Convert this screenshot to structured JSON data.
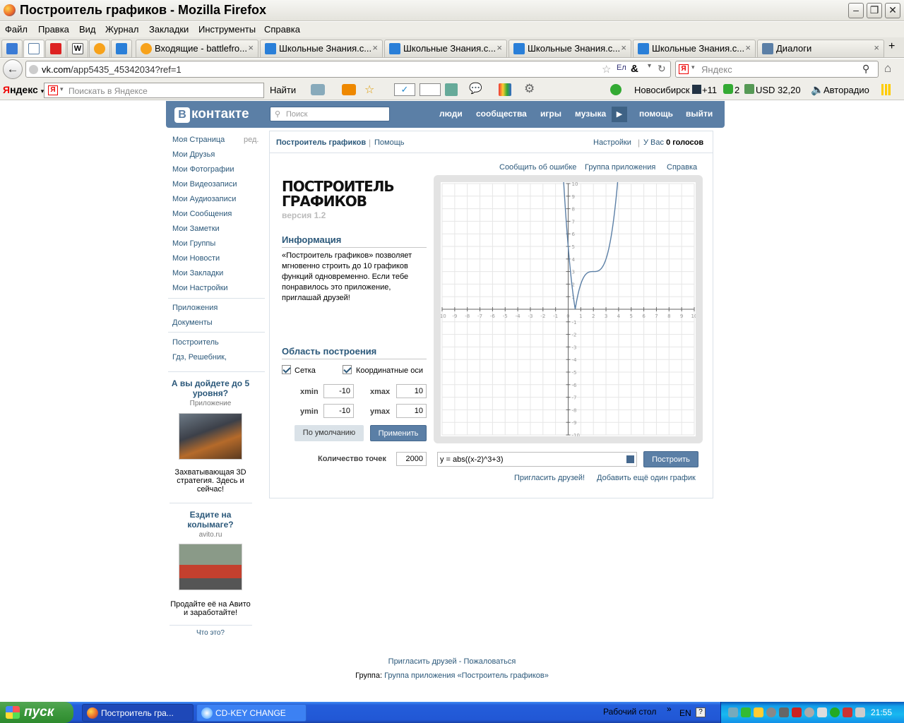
{
  "window": {
    "title": "Построитель графиков - Mozilla Firefox"
  },
  "menu": [
    "Файл",
    "Правка",
    "Вид",
    "Журнал",
    "Закладки",
    "Инструменты",
    "Справка"
  ],
  "tabs": [
    {
      "label": "Входящие - battlefro..."
    },
    {
      "label": "Школьные Знания.c..."
    },
    {
      "label": "Школьные Знания.c..."
    },
    {
      "label": "Школьные Знания.c..."
    },
    {
      "label": "Школьные Знания.c..."
    },
    {
      "label": "Диалоги"
    }
  ],
  "url": {
    "host": "vk.com",
    "path": "/app5435_45342034?ref=1"
  },
  "search": {
    "placeholder": "Яндекс"
  },
  "yandex": {
    "logo_y": "Я",
    "logo_rest": "ндекс",
    "placeholder": "Поискать в Яндексе",
    "find": "Найти",
    "city": "Новосибирск",
    "temp": "+11",
    "mail": "2",
    "usd": "USD 32,20",
    "radio": "Авторадио"
  },
  "vk": {
    "logo": "контакте",
    "logo_b": "В",
    "search_placeholder": "Поиск",
    "nav": [
      "люди",
      "сообщества",
      "игры",
      "музыка",
      "помощь",
      "выйти"
    ],
    "left_menu": [
      "Моя Страница",
      "Мои Друзья",
      "Мои Фотографии",
      "Мои Видеозаписи",
      "Мои Аудиозаписи",
      "Мои Сообщения",
      "Мои Заметки",
      "Мои Группы",
      "Мои Новости",
      "Мои Закладки",
      "Мои Настройки"
    ],
    "edit": "ред.",
    "left_menu2": [
      "Приложения",
      "Документы"
    ],
    "left_menu3": [
      "Построитель",
      "Гдз, Решебник,"
    ],
    "ad1": {
      "title": "А вы дойдете до 5 уровня?",
      "sub": "Приложение",
      "text": "Захватывающая 3D стратегия. Здесь и сейчас!"
    },
    "ad2": {
      "title": "Ездите на колымаге?",
      "sub": "avito.ru",
      "text": "Продайте её на Авито и заработайте!"
    },
    "what": "Что это?"
  },
  "app": {
    "head_title": "Построитель графиков",
    "head_help": "Помощь",
    "settings": "Настройки",
    "votes_prefix": "У Вас",
    "votes": "0 голосов",
    "links": [
      "Сообщить об ошибке",
      "Группа приложения",
      "Справка"
    ],
    "title_l1": "ПОСТРОИТЕЛЬ",
    "title_l2": "ГРАФИКОВ",
    "version": "версия 1.2",
    "info_h": "Информация",
    "info": "«Построитель графиков» позволяет мгновенно строить до 10 графиков функций одновременно. Если тебе понравилось это приложение, приглашай друзей!",
    "area_h": "Область построения",
    "grid": "Сетка",
    "axes": "Координатные оси",
    "xmin_l": "xmin",
    "xmin": "-10",
    "xmax_l": "xmax",
    "xmax": "10",
    "ymin_l": "ymin",
    "ymin": "-10",
    "ymax_l": "ymax",
    "ymax": "10",
    "btn_default": "По умолчанию",
    "btn_apply": "Применить",
    "points_l": "Количество точек",
    "points": "2000",
    "func": "y = abs((x-2)^3+3)",
    "btn_plot": "Построить",
    "invite": "Пригласить друзей!",
    "add_graph": "Добавить ещё один график"
  },
  "chart_data": {
    "type": "line",
    "function": "y = abs((x-2)^3+3)",
    "xlim": [
      -10,
      10
    ],
    "ylim": [
      -10,
      10
    ],
    "grid": true,
    "x_ticks": [
      -10,
      -9,
      -8,
      -7,
      -6,
      -5,
      -4,
      -3,
      -2,
      -1,
      0,
      1,
      2,
      3,
      4,
      5,
      6,
      7,
      8,
      9,
      10
    ],
    "y_ticks": [
      -10,
      -9,
      -8,
      -7,
      -6,
      -5,
      -4,
      -3,
      -2,
      -1,
      1,
      2,
      3,
      4,
      5,
      6,
      7,
      8,
      9,
      10
    ],
    "line_color": "#5b7fa6"
  },
  "footer": {
    "invite": "Пригласить друзей",
    "dash": " - ",
    "complain": "Пожаловаться",
    "group_l": "Группа: ",
    "group": "Группа приложения «Построитель графиков»"
  },
  "taskbar": {
    "start": "пуск",
    "tasks": [
      "Построитель гра...",
      "CD-KEY CHANGE"
    ],
    "desktop": "Рабочий стол",
    "lang": "EN",
    "time": "21:55"
  }
}
